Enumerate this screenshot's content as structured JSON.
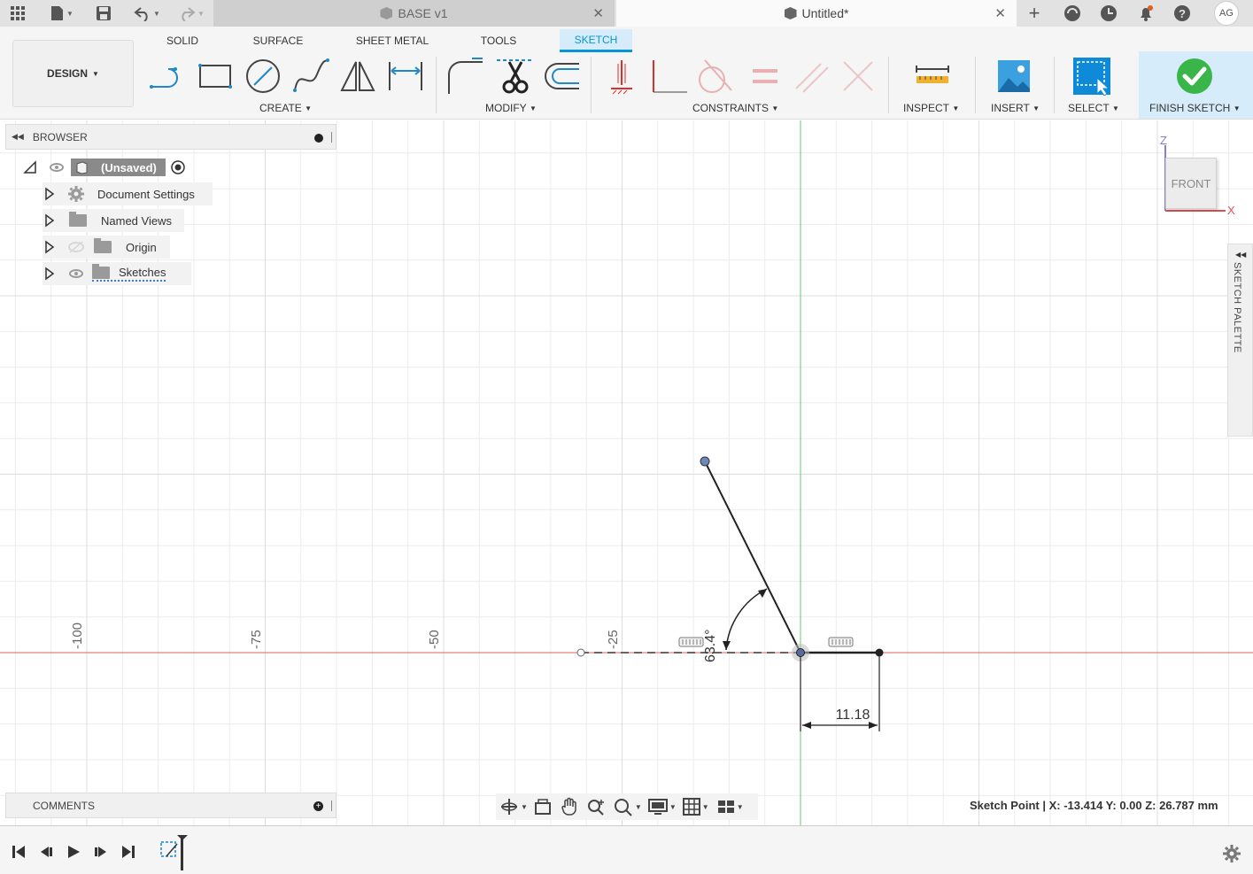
{
  "titlebar": {
    "tab_base": "BASE v1",
    "tab_untitled": "Untitled*",
    "avatar": "AG"
  },
  "ribbon": {
    "tabs": [
      "SOLID",
      "SURFACE",
      "SHEET METAL",
      "TOOLS",
      "SKETCH"
    ],
    "active_tab": "SKETCH",
    "design": "DESIGN",
    "groups": [
      "CREATE",
      "MODIFY",
      "CONSTRAINTS",
      "INSPECT",
      "INSERT",
      "SELECT",
      "FINISH SKETCH"
    ],
    "accent": "#0696d7"
  },
  "browser": {
    "title": "BROWSER",
    "root": "(Unsaved)",
    "items": [
      "Document Settings",
      "Named Views",
      "Origin",
      "Sketches"
    ]
  },
  "comments": {
    "title": "COMMENTS"
  },
  "viewcube": {
    "face": "FRONT",
    "axis_z": "Z",
    "axis_x": "X"
  },
  "palette": {
    "label": "SKETCH PALETTE"
  },
  "ruler": {
    "labels": [
      "-100",
      "-75",
      "-50",
      "-25"
    ]
  },
  "sketch": {
    "angle_dim": "63.4°",
    "length_dim": "11.18"
  },
  "status": {
    "text": "Sketch Point | X: -13.414 Y: 0.00 Z: 26.787 mm"
  },
  "colors": {
    "x_axis": "#e06060",
    "z_axis": "#66cc66",
    "grid": "#e6e6e6"
  }
}
